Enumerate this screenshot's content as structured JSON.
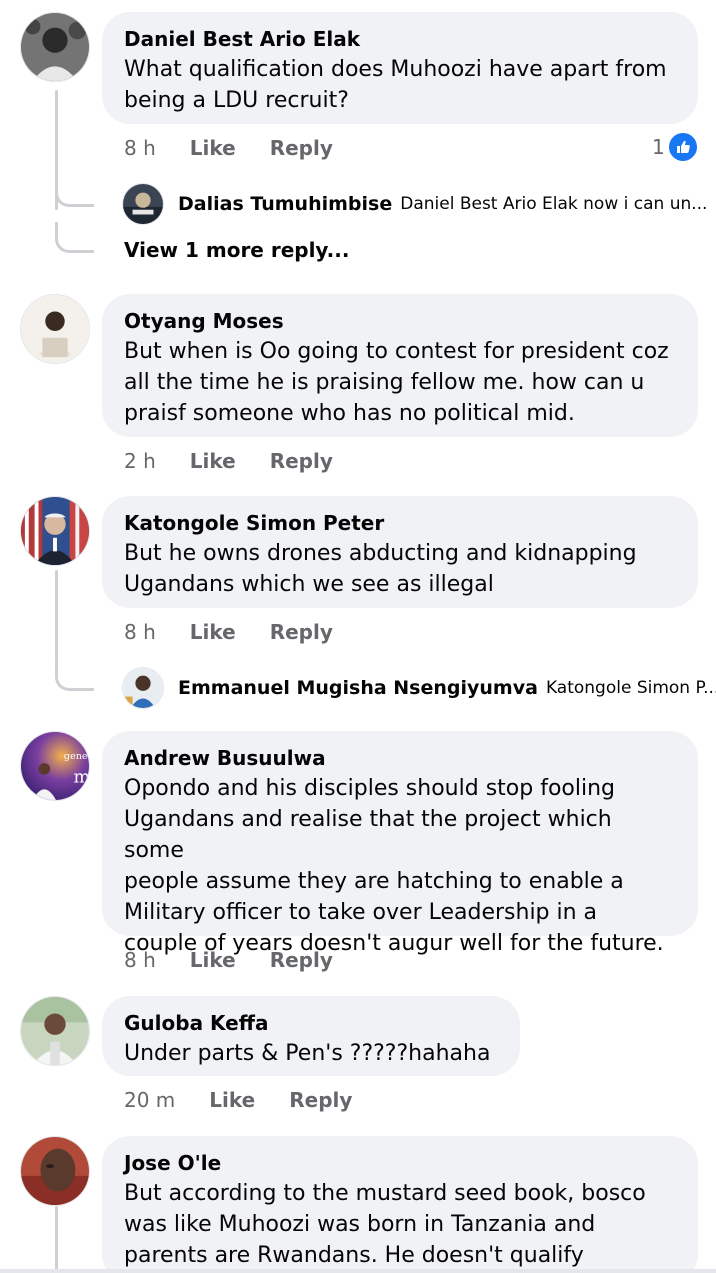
{
  "comments": [
    {
      "author": "Daniel Best Ario Elak",
      "text": "What qualification does Muhoozi have apart from\nbeing a LDU recruit?",
      "time": "8 h",
      "like_label": "Like",
      "reply_label": "Reply",
      "reaction_count": "1",
      "reply_preview": {
        "author": "Dalias Tumuhimbise",
        "snippet": "Daniel Best Ario Elak now i can un..."
      },
      "view_more": "View 1 more reply..."
    },
    {
      "author": "Otyang Moses",
      "text": "But when is Oo going to contest for president coz\nall the time he is praising fellow me. how can u\npraisf someone who has no political mid.",
      "time": "2 h",
      "like_label": "Like",
      "reply_label": "Reply"
    },
    {
      "author": "Katongole Simon Peter",
      "text": "But he owns drones abducting and kidnapping\nUgandans which we see as illegal",
      "time": "8 h",
      "like_label": "Like",
      "reply_label": "Reply",
      "reply_preview": {
        "author": "Emmanuel Mugisha Nsengiyumva",
        "snippet": "Katongole Simon P..."
      }
    },
    {
      "author": "Andrew Busuulwa",
      "text": "Opondo and his disciples should stop fooling\nUgandans and realise that the project which some\npeople assume they are hatching to enable a\nMilitary officer to take over Leadership in a\ncouple of years doesn't augur well for the future.",
      "time": "8 h",
      "like_label": "Like",
      "reply_label": "Reply"
    },
    {
      "author": "Guloba Keffa",
      "text": "Under parts & Pen's ?????hahaha",
      "time": "20 m",
      "like_label": "Like",
      "reply_label": "Reply"
    },
    {
      "author": "Jose O'le",
      "text": "But according to the mustard seed book, bosco\nwas like Muhoozi was born in Tanzania and\nparents are Rwandans. He doesn't qualify",
      "time": "",
      "like_label": "",
      "reply_label": ""
    }
  ],
  "icons": {
    "reaction": "like-thumbs-up-icon"
  },
  "colors": {
    "bubble": "#f0f2f5",
    "secondary_text": "#65676b",
    "like_blue": "#1877f2",
    "thread_line": "#ced0d4"
  }
}
